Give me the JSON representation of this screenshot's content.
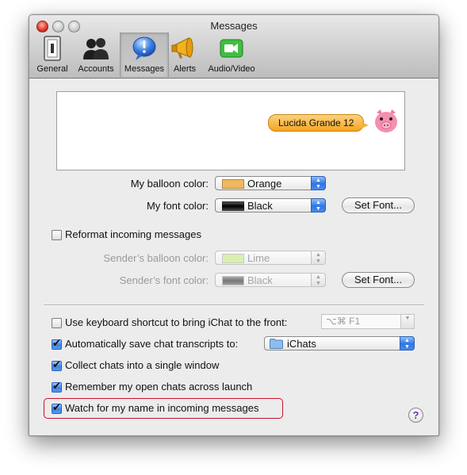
{
  "window": {
    "title": "Messages"
  },
  "toolbar": {
    "items": [
      {
        "label": "General",
        "icon": "switch-icon",
        "selected": false
      },
      {
        "label": "Accounts",
        "icon": "people-icon",
        "selected": false
      },
      {
        "label": "Messages",
        "icon": "speech-bubble-icon",
        "selected": true
      },
      {
        "label": "Alerts",
        "icon": "megaphone-icon",
        "selected": false
      },
      {
        "label": "Audio/Video",
        "icon": "video-camera-icon",
        "selected": false
      }
    ]
  },
  "preview": {
    "balloon_text": "Lucida Grande 12",
    "balloon_color": "#f4b13a",
    "avatar_icon": "pig-icon"
  },
  "my_settings": {
    "balloon_color_label": "My balloon color:",
    "balloon_color_value": "Orange",
    "balloon_swatch": "#f0b760",
    "font_color_label": "My font color:",
    "font_color_value": "Black",
    "font_swatch": "#111111",
    "set_font_label": "Set Font..."
  },
  "incoming": {
    "reformat_label": "Reformat incoming messages",
    "reformat_checked": false,
    "sender_balloon_label": "Sender’s balloon color:",
    "sender_balloon_value": "Lime",
    "sender_balloon_swatch": "#d8f0b0",
    "sender_font_label": "Sender’s font color:",
    "sender_font_value": "Black",
    "sender_font_swatch": "#8a8a8a",
    "set_font_label": "Set Font..."
  },
  "options": {
    "shortcut_label": "Use keyboard shortcut to bring iChat to the front:",
    "shortcut_checked": false,
    "shortcut_value": "⌥⌘ F1",
    "save_transcripts_label": "Automatically save chat transcripts to:",
    "save_transcripts_checked": true,
    "transcripts_folder": "iChats",
    "collect_label": "Collect chats into a single window",
    "collect_checked": true,
    "remember_label": "Remember my open chats across launch",
    "remember_checked": true,
    "watch_name_label": "Watch for my name in incoming messages",
    "watch_name_checked": true
  },
  "help": {
    "label": "?"
  },
  "colors": {
    "accent": "#3d82e6",
    "highlight_border": "#c8102e"
  }
}
